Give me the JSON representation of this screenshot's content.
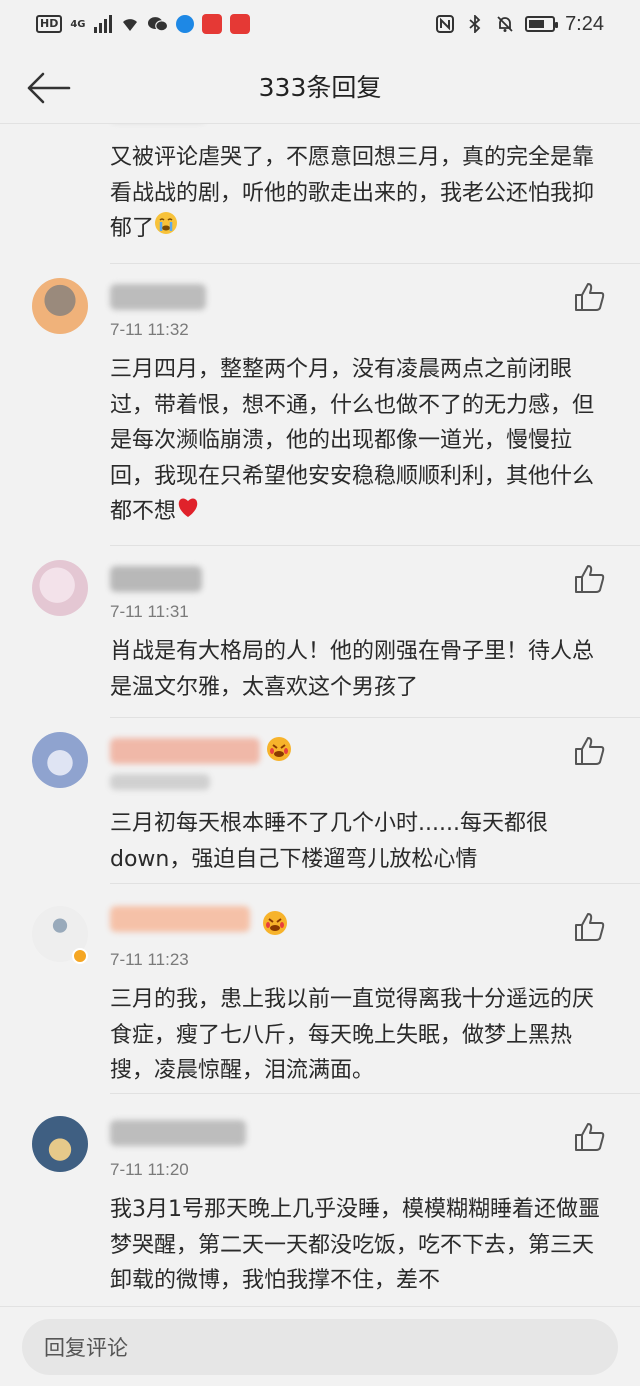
{
  "status_bar": {
    "network_hd": "HD",
    "network_gen": "4G",
    "time": "7:24",
    "battery_percent": 70
  },
  "header": {
    "title": "333条回复"
  },
  "comments": [
    {
      "time": "",
      "text": "又被评论虐哭了，不愿意回想三月，真的完全是靠看战战的剧，听他的歌走出来的，我老公还怕我抑郁了",
      "emoji": "😭",
      "avatar_color": ""
    },
    {
      "time": "7-11 11:32",
      "text": "三月四月，整整两个月，没有凌晨两点之前闭眼过，带着恨，想不通，什么也做不了的无力感，但是每次濒临崩溃，他的出现都像一道光，慢慢拉回，我现在只希望他安安稳稳顺顺利利，其他什么都不想",
      "emoji": "❤️",
      "avatar_color": "#d9a06a"
    },
    {
      "time": "7-11 11:31",
      "text": "肖战是有大格局的人！他的刚强在骨子里！待人总是温文尔雅，太喜欢这个男孩了",
      "emoji": "",
      "avatar_color": "#e9d4df"
    },
    {
      "time": "",
      "text": "三月初每天根本睡不了几个小时......每天都很down，强迫自己下楼遛弯儿放松心情",
      "emoji": "",
      "avatar_color": "#8fa3cf"
    },
    {
      "time": "7-11 11:23",
      "text": "三月的我，患上我以前一直觉得离我十分遥远的厌食症，瘦了七八斤，每天晚上失眠，做梦上黑热搜，凌晨惊醒，泪流满面。",
      "emoji": "",
      "avatar_color": "#e8e8e8"
    },
    {
      "time": "7-11 11:20",
      "text": "我3月1号那天晚上几乎没睡，模模糊糊睡着还做噩梦哭醒，第二天一天都没吃饭，吃不下去，第三天卸载的微博，我怕我撑不住，差不",
      "emoji": "",
      "avatar_color": "#4a6a8a"
    }
  ],
  "colors": {
    "background": "#f2f2f2",
    "time_gray": "#7a7a7a",
    "heart_red": "#e0222b"
  },
  "bottom_bar": {
    "reply_placeholder": "回复评论"
  }
}
